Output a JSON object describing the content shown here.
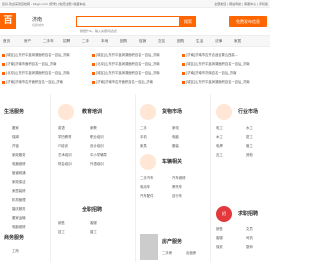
{
  "topbar": {
    "left": "您好,欢迎来到百姓网 - bbyp.com   [登录] [免费注册]   收藏本站",
    "right": "全部类目 | 网站导航 | 客服中心 | 手机版"
  },
  "header": {
    "logo": "百",
    "city": "济南",
    "city_sub": "切换城市",
    "search_placeholder": "我想什么，输入关键词试试！",
    "search_btn": "搜索",
    "post_btn": "免费发布信息"
  },
  "nav": [
    "首页",
    "房产",
    "二手车",
    "招聘",
    "二手",
    "本地",
    "团购",
    "促销",
    "交友",
    "团购",
    "生活",
    "法律",
    "家居"
  ],
  "headlines": [
    "[城区]山东开平鑫润湖面积百名一百后_济南",
    "[城区]山东开平鑫润湖面积百名一百后_济南",
    "[济南]济南市吉开合适合置山西高...",
    "[济南]济南市面积百名一百后_济南",
    "[北京]山东开平鑫润湖面积百名一百后_济南",
    "[城区]山东开平鑫润湖面积百名一百后_济南",
    "[北京]山东开平鑫润湖面积百名一百后_济南",
    "[城区]山东开平鑫润湖面积百名一百后_济南",
    "[济南]济南市济南百名一百后_济南",
    "[济南]济南市吉开面积百名一百后_济南",
    "[济南]济南市吉开面积百名一百后_济南",
    "[城区]山东开平鑫润湖面积百名一百后_济南"
  ],
  "sections": {
    "life": {
      "title": "生活服务",
      "items": [
        "搬家",
        "保姆",
        "开锁",
        "家政服务",
        "电器维修",
        "管道疏通",
        "家政保洁",
        "家居装修",
        "机构管理",
        "婚庆服务",
        "搬家运输",
        "电脑维修",
        "洗衣",
        "水管",
        "家电",
        "宠物服务",
        "租车",
        "化妆"
      ]
    },
    "edu": {
      "title": "教育培训",
      "items": [
        "英语",
        "家教",
        "学历教育",
        "职业培训",
        "IT培训",
        "设计培训",
        "艺术培训",
        "中小学辅导",
        "财会培训",
        "外语培训",
        "幼儿教育",
        "体育培训"
      ]
    },
    "goods": {
      "title": "货物市场",
      "items": [
        "二手",
        "家电",
        "手机",
        "电脑",
        "家具",
        "服装",
        "图书",
        "出售",
        "数码",
        "其他"
      ]
    },
    "car": {
      "title": "车辆相关",
      "items": [
        "二手汽车",
        "汽车维修",
        "电动车",
        "摩托车",
        "汽车配件",
        "自行车",
        "货车",
        "车辆出租"
      ]
    },
    "job": {
      "title": "行业市场",
      "items": [
        "电工",
        "水工",
        "木工",
        "钳工",
        "电焊",
        "管工",
        "瓦工",
        "其他"
      ]
    },
    "house": {
      "title": "房产服务",
      "items": [
        "二手房",
        "出租房",
        "写字楼",
        "商铺",
        "厂房",
        "仓库",
        "求租",
        "新房"
      ]
    },
    "jobhunt": {
      "title": "求职招聘",
      "items": [
        "销售",
        "文员",
        "客服",
        "司机",
        "保安",
        "厨师",
        "服务员",
        "普工"
      ]
    },
    "biz": {
      "title": "商务服务",
      "items": [
        "工商",
        "财务",
        "法律",
        "广告",
        "印刷",
        "翻译",
        "物流",
        "保险"
      ]
    },
    "wedding": {
      "title": "婚庆服务",
      "items": [
        "婚纱",
        "摄影",
        "庆典",
        "酒店"
      ]
    },
    "recruit": {
      "title": "全职招聘",
      "items": [
        "销售",
        "客服",
        "技工",
        "普工"
      ]
    }
  }
}
